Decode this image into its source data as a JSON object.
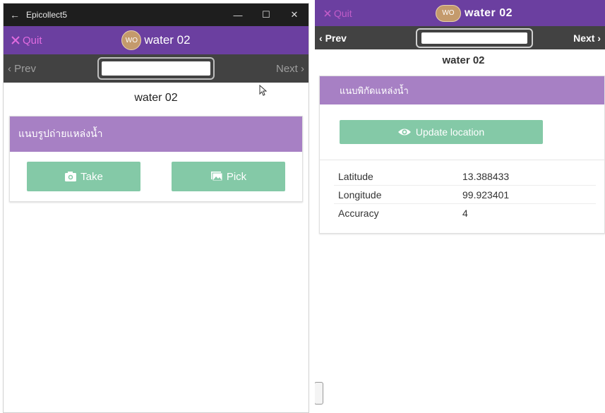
{
  "left_window": {
    "titlebar": {
      "back": "←",
      "app_name": "Epicollect5",
      "minimize": "—",
      "maximize": "☐",
      "close": "✕"
    },
    "appbar": {
      "quit_label": "Quit",
      "avatar_initials": "WO",
      "title": "water 02"
    },
    "nav": {
      "prev_label": "Prev",
      "next_label": "Next"
    },
    "question_title": "water 02",
    "card": {
      "heading": "แนบรูปถ่ายแหล่งน้ำ",
      "take_label": "Take",
      "pick_label": "Pick"
    }
  },
  "right_window": {
    "appbar": {
      "quit_label": "Quit",
      "avatar_initials": "WO",
      "title": "water 02"
    },
    "nav": {
      "prev_label": "Prev",
      "next_label": "Next"
    },
    "question_title": "water 02",
    "card": {
      "heading": "แนบพิกัดแหล่งน้ำ",
      "update_label": "Update location",
      "rows": [
        {
          "label": "Latitude",
          "value": "13.388433"
        },
        {
          "label": "Longitude",
          "value": "99.923401"
        },
        {
          "label": "Accuracy",
          "value": "4"
        }
      ]
    }
  },
  "colors": {
    "appbar": "#6b3fa0",
    "card_header": "#a780c4",
    "button": "#84c9a7",
    "navbar": "#424242",
    "quit": "#e06be0"
  }
}
